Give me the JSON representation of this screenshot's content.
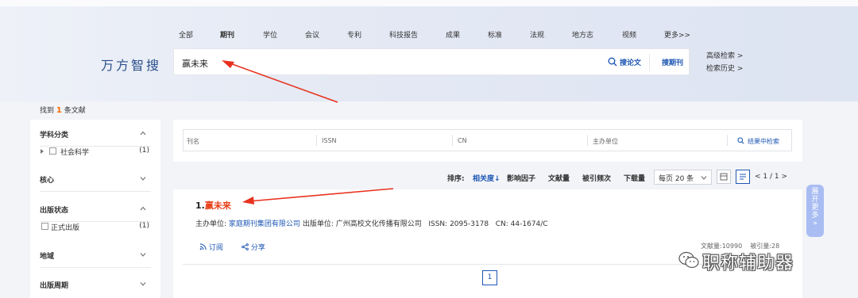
{
  "nav": {
    "tabs": [
      "全部",
      "期刊",
      "学位",
      "会议",
      "专利",
      "科技报告",
      "成果",
      "标准",
      "法规",
      "地方志",
      "视频",
      "更多>>"
    ],
    "active": "期刊"
  },
  "brand": "万方智搜",
  "search": {
    "value": "赢未来",
    "search_paper_label": "搜论文",
    "search_journal_label": "搜期刊"
  },
  "side_links": {
    "advanced": "高级检索 >",
    "history": "检索历史 >"
  },
  "found": {
    "prefix": "找到",
    "count": "1",
    "suffix": "条文献"
  },
  "sidebar": {
    "subject": {
      "title": "学科分类",
      "item_label": "社会科学",
      "item_count": "(1)"
    },
    "core": {
      "title": "核心"
    },
    "status": {
      "title": "出版状态",
      "item_label": "正式出版",
      "item_count": "(1)"
    },
    "region": {
      "title": "地域"
    },
    "cycle": {
      "title": "出版周期"
    }
  },
  "filter": {
    "fields": [
      "刊名",
      "ISSN",
      "CN",
      "主办单位"
    ],
    "search_in_results": "结果中检索"
  },
  "sort": {
    "label": "排序:",
    "relevance": "相关度↓",
    "impact": "影响因子",
    "docs": "文献量",
    "citations": "被引频次",
    "downloads": "下载量",
    "per_page": "每页 20 条",
    "page_info": "1 / 1"
  },
  "result": {
    "index": "1.",
    "title": "赢未来",
    "sponsor_label": "主办单位:",
    "sponsor": "家庭期刊集团有限公司",
    "publisher_label": "出版单位:",
    "publisher": "广州高校文化传播有限公司",
    "issn_label": "ISSN:",
    "issn": "2095-3178",
    "cn_label": "CN:",
    "cn": "44-1674/C",
    "subscribe": "订阅",
    "share": "分享",
    "doc_count_label": "文献量:",
    "doc_count": "10990",
    "cited_label": "被引量:",
    "cited": "28",
    "page": "1"
  },
  "expand_label": "展开更多",
  "watermark": "职称辅助器",
  "colors": {
    "accent": "#1e57b4",
    "highlight": "#e8411b",
    "count": "#ff6b00",
    "arrow": "#e8321e"
  }
}
